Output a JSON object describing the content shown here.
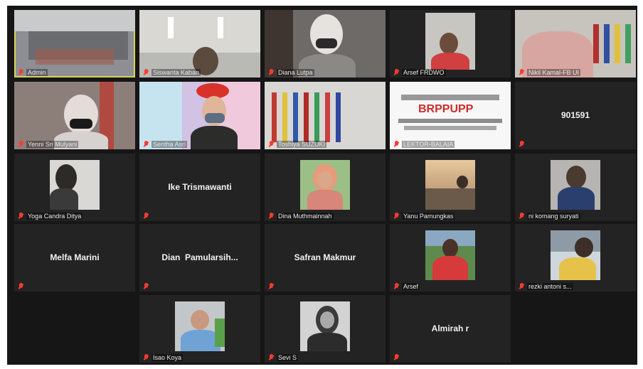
{
  "participants": [
    {
      "name": "Admin"
    },
    {
      "name": "Siswanta Kaban"
    },
    {
      "name": "Diana Lutpa"
    },
    {
      "name": "Arsef FRDWO"
    },
    {
      "name": "Nikil Kamal-FB UI"
    },
    {
      "name": "Yenni Sri Mulyani"
    },
    {
      "name": "Sentha Asri"
    },
    {
      "name": "Toshiya SUZUKI"
    },
    {
      "name": "LEKTOR-BALAIA",
      "wordcloud_text": "BRPPUPP"
    },
    {
      "name": "901591",
      "display_name": "901591"
    },
    {
      "name": "Yoga Candra Ditya"
    },
    {
      "name": "Ike Trismawanti",
      "display_name": "Ike Trismawanti"
    },
    {
      "name": "Dina Muthmainnah"
    },
    {
      "name": "Yanu Pamungkas"
    },
    {
      "name": "ni komang suryati"
    },
    {
      "name": "Melfa Marini",
      "display_name": "Melfa Marini"
    },
    {
      "name": "Dian Pamularsih...",
      "display_name": "Dian  Pamularsih..."
    },
    {
      "name": "Safran Makmur",
      "display_name": "Safran Makmur"
    },
    {
      "name": "Arsef"
    },
    {
      "name": "rezki antoni s..."
    },
    {
      "name": "Isao Koya"
    },
    {
      "name": "Sevi S"
    },
    {
      "name": "Almirah r",
      "display_name": "Almirah r"
    }
  ],
  "icons": {
    "muted": "mic-muted-icon"
  },
  "colors": {
    "background": "#161616",
    "tile": "#232323",
    "active_border": "#d8d35a",
    "mic_muted": "#ff3b30"
  }
}
